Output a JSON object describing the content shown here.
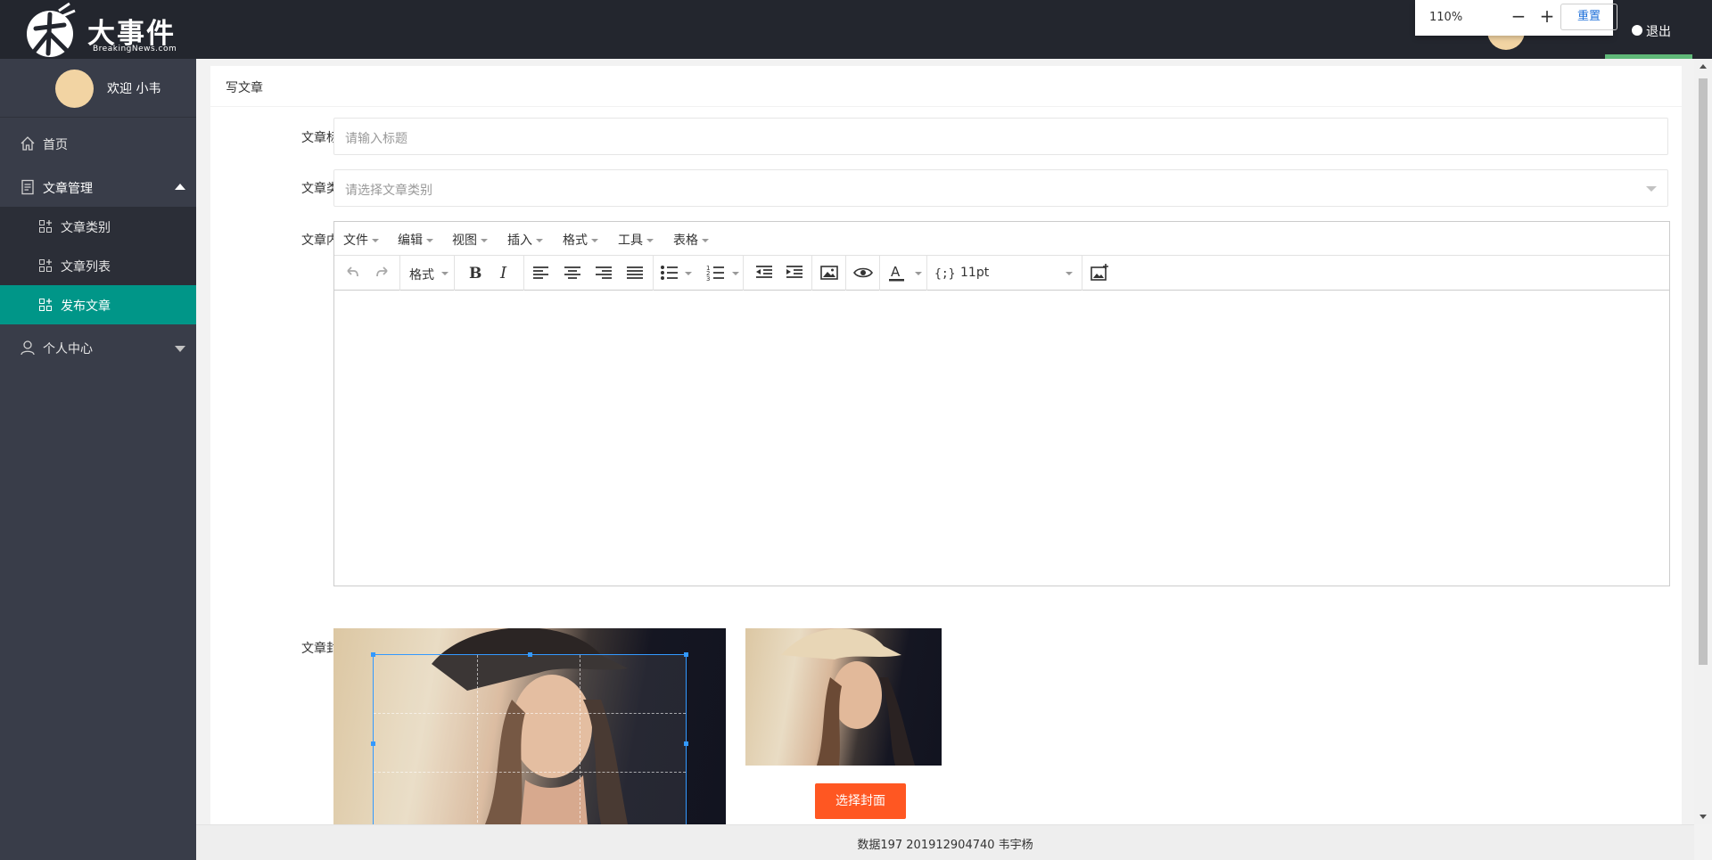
{
  "app": {
    "logo_title": "大事件",
    "logo_sub": "BreakingNews.com",
    "logout_label": "退出"
  },
  "browser_zoom": {
    "level": "110%",
    "minus": "−",
    "plus": "+",
    "reset_label": "重置"
  },
  "sidebar": {
    "welcome": "欢迎  小韦",
    "items": [
      {
        "label": "首页",
        "icon": "home-icon"
      },
      {
        "label": "文章管理",
        "icon": "document-icon",
        "expanded": true
      },
      {
        "label": "个人中心",
        "icon": "user-icon",
        "expanded": false
      }
    ],
    "sub_items": [
      {
        "label": "文章类别",
        "icon": "grid-add-icon"
      },
      {
        "label": "文章列表",
        "icon": "grid-add-icon"
      },
      {
        "label": "发布文章",
        "icon": "grid-add-icon",
        "active": true
      }
    ],
    "active_color": "#009688"
  },
  "page": {
    "card_title": "写文章",
    "title_label": "文章标题",
    "title_placeholder": "请输入标题",
    "category_label": "文章类别",
    "category_placeholder": "请选择文章类别",
    "content_label": "文章内容",
    "cover_label": "文章封面",
    "choose_cover_button": "选择封面",
    "choose_button_color": "#ff5722"
  },
  "editor": {
    "menus": [
      "文件",
      "编辑",
      "视图",
      "插入",
      "格式",
      "工具",
      "表格"
    ],
    "format_label": "格式",
    "font_size": "11pt",
    "toolbar_icons": [
      "undo-icon",
      "redo-icon",
      "bold-icon",
      "italic-icon",
      "align-left-icon",
      "align-center-icon",
      "align-right-icon",
      "align-justify-icon",
      "bullet-list-icon",
      "numbered-list-icon",
      "outdent-icon",
      "indent-icon",
      "image-icon",
      "preview-icon",
      "text-color-icon",
      "code-icon",
      "upload-image-icon"
    ]
  },
  "footer": {
    "text": "数据197 201912904740 韦宇杨"
  }
}
